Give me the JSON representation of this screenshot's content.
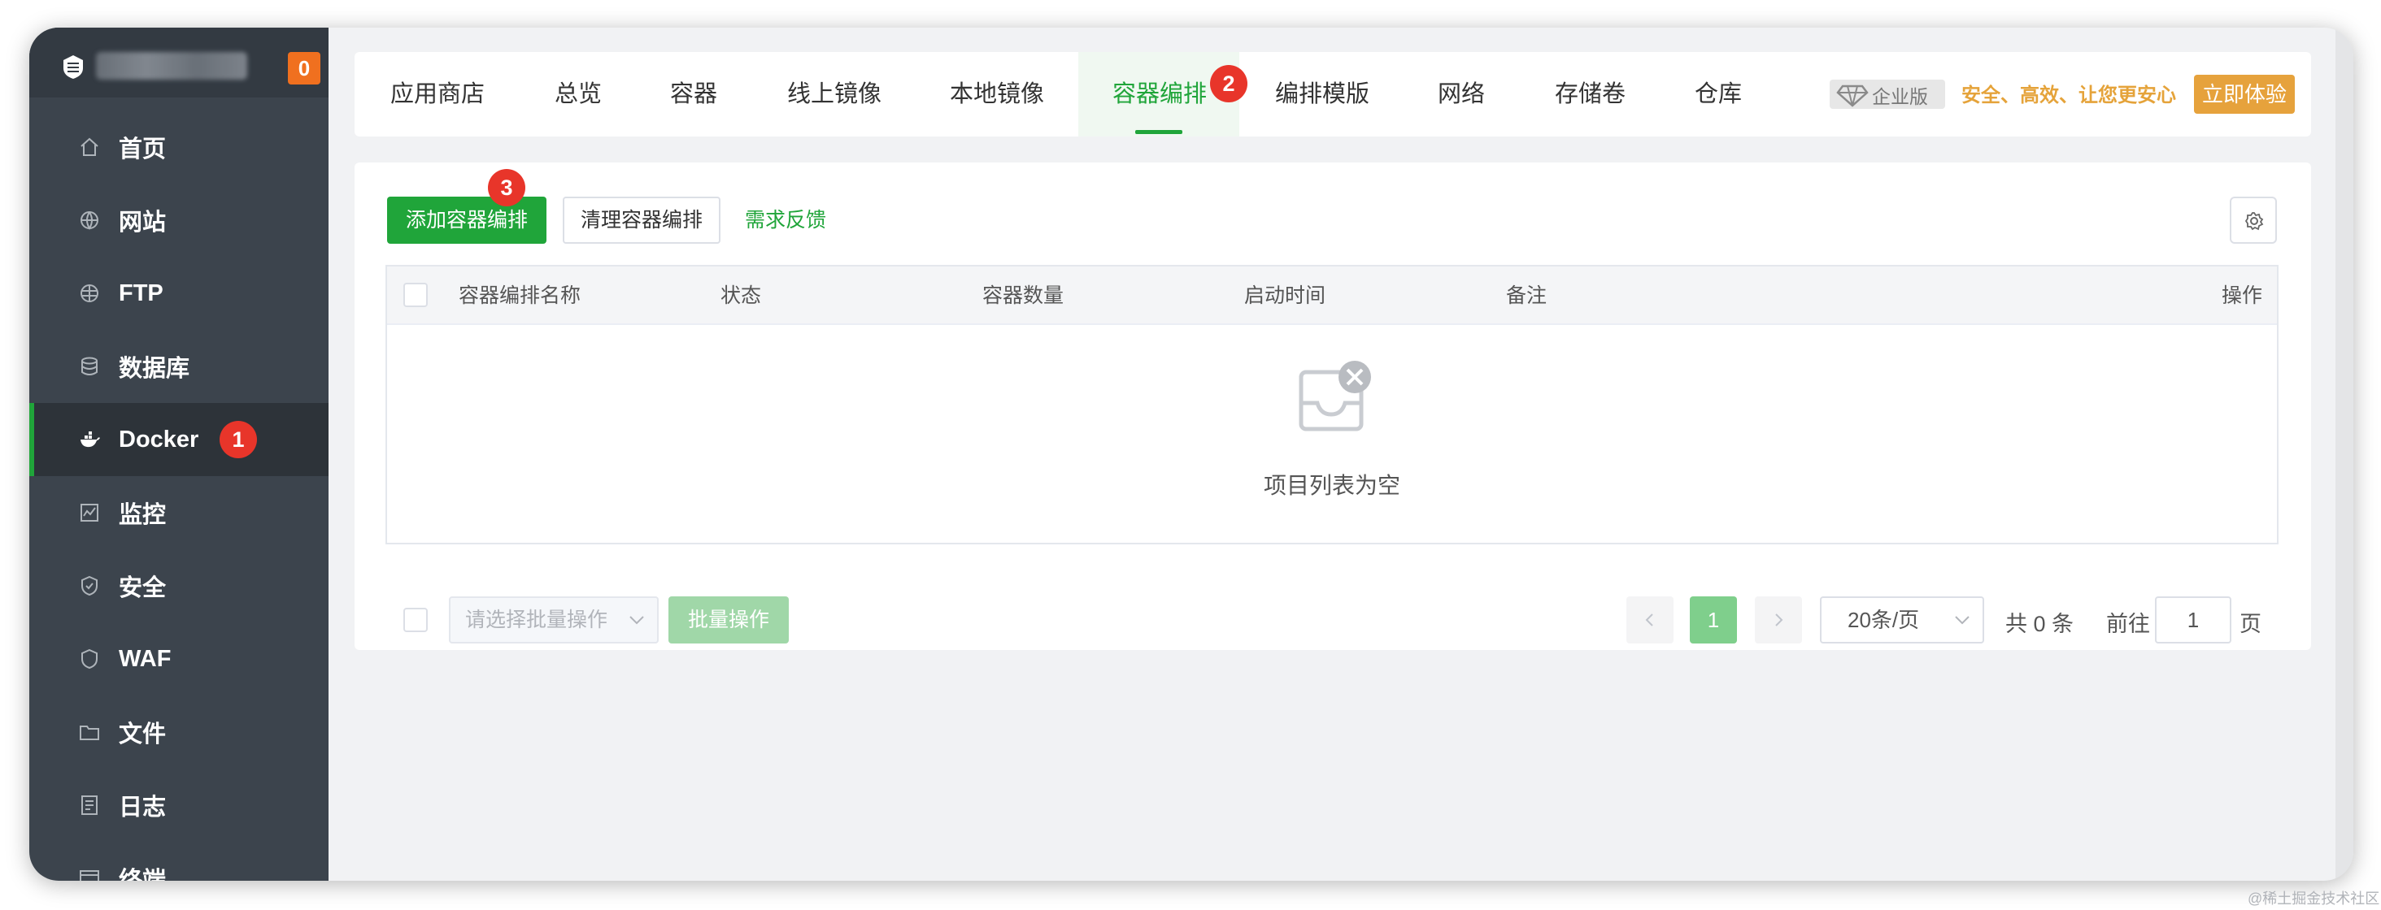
{
  "sidebar": {
    "notification_count": "0",
    "items": [
      {
        "label": "首页",
        "icon": "home-icon"
      },
      {
        "label": "网站",
        "icon": "globe-icon"
      },
      {
        "label": "FTP",
        "icon": "ftp-globe-icon"
      },
      {
        "label": "数据库",
        "icon": "database-icon"
      },
      {
        "label": "Docker",
        "icon": "docker-icon",
        "active": true,
        "step_badge": "1"
      },
      {
        "label": "监控",
        "icon": "monitor-icon"
      },
      {
        "label": "安全",
        "icon": "shield-icon"
      },
      {
        "label": "WAF",
        "icon": "waf-shield-icon"
      },
      {
        "label": "文件",
        "icon": "folder-icon"
      },
      {
        "label": "日志",
        "icon": "log-icon"
      },
      {
        "label": "终端",
        "icon": "terminal-icon"
      }
    ]
  },
  "tabs": {
    "items": [
      "应用商店",
      "总览",
      "容器",
      "线上镜像",
      "本地镜像",
      "容器编排",
      "编排模版",
      "网络",
      "存储卷",
      "仓库"
    ],
    "active_index": 5,
    "step_badge": "2",
    "enterprise_label": "企业版",
    "promo_text": "安全、高效、让您更安心",
    "try_button": "立即体验"
  },
  "toolbar": {
    "add_button": "添加容器编排",
    "add_step_badge": "3",
    "clean_button": "清理容器编排",
    "feedback_link": "需求反馈"
  },
  "table": {
    "columns": [
      "容器编排名称",
      "状态",
      "容器数量",
      "启动时间",
      "备注",
      "操作"
    ],
    "rows": [],
    "empty_text": "项目列表为空"
  },
  "footer": {
    "batch_placeholder": "请选择批量操作",
    "batch_button": "批量操作",
    "current_page": "1",
    "page_size": "20条/页",
    "total": "共 0 条",
    "goto_label": "前往",
    "goto_value": "1",
    "page_unit": "页"
  },
  "watermark": "@稀土掘金技术社区",
  "colors": {
    "accent": "#20a53a",
    "sidebar_bg": "#3c444d",
    "badge_red": "#e8352a",
    "promo_gold": "#e6a23c"
  }
}
